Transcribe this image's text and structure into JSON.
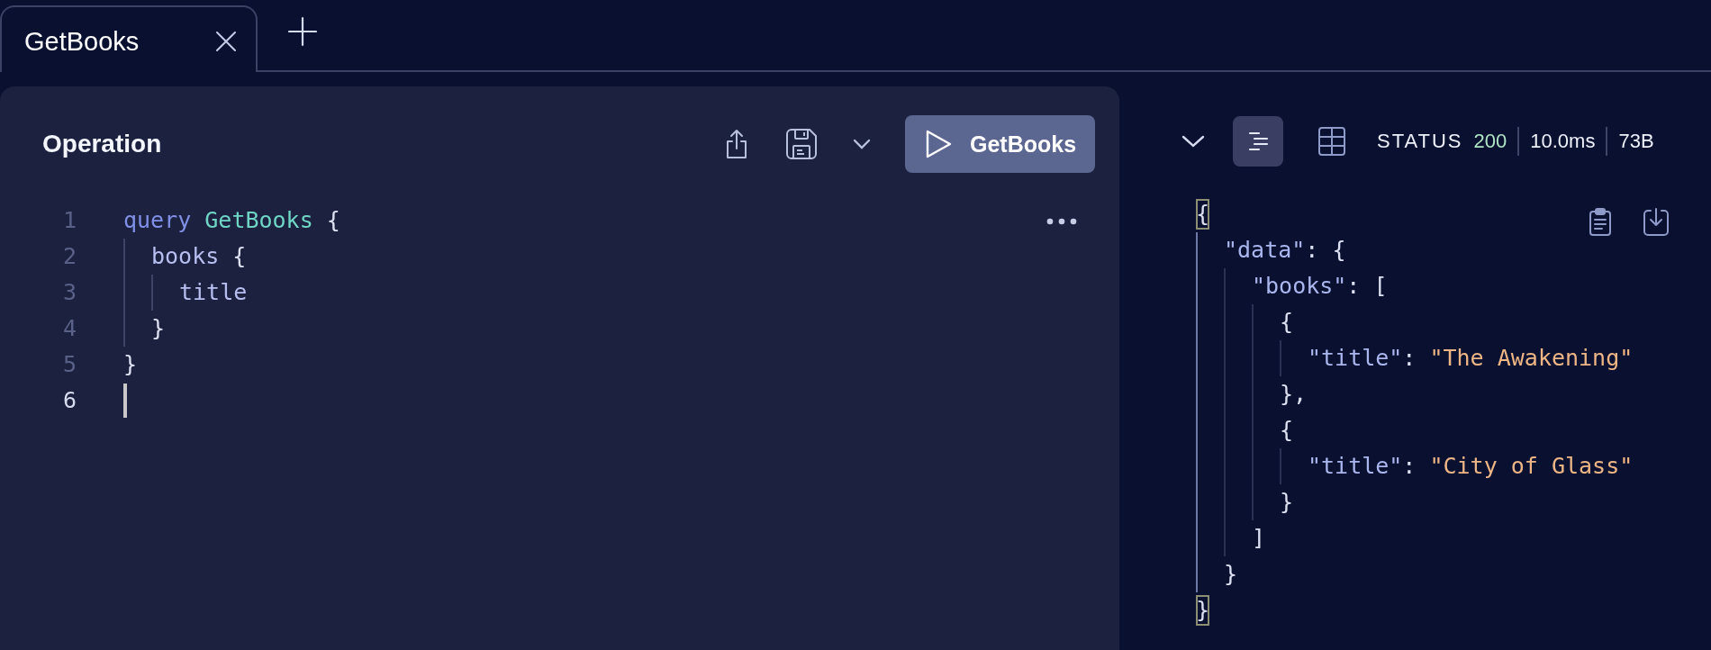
{
  "tabs": [
    {
      "label": "GetBooks",
      "selected": true
    }
  ],
  "operation": {
    "title": "Operation",
    "run_label": "GetBooks",
    "lines": [
      {
        "number": "1",
        "active": false,
        "tokens": [
          {
            "kind": "keyword",
            "text": "query"
          },
          {
            "kind": "name",
            "text": " GetBooks"
          },
          {
            "kind": "punct",
            "text": " {"
          }
        ],
        "children": [
          {
            "number": "2",
            "active": false,
            "tokens": [
              {
                "kind": "field",
                "text": "books"
              },
              {
                "kind": "punct",
                "text": " {"
              }
            ],
            "children": [
              {
                "number": "3",
                "active": false,
                "tokens": [
                  {
                    "kind": "field",
                    "text": "title"
                  }
                ]
              }
            ]
          },
          {
            "number": "4",
            "active": false,
            "tokens": [
              {
                "kind": "punct",
                "text": "}"
              }
            ]
          }
        ]
      },
      {
        "number": "5",
        "active": false,
        "tokens": [
          {
            "kind": "punct",
            "text": "}"
          }
        ]
      },
      {
        "number": "6",
        "active": true
      }
    ]
  },
  "response": {
    "view_modes": [
      {
        "kind": "formatted",
        "selected": true
      },
      {
        "kind": "table",
        "selected": false
      }
    ],
    "status_label": "STATUS",
    "status_code": "200",
    "time": "10.0ms",
    "size": "73B",
    "lines": [
      {
        "matched": true,
        "tokens": [
          {
            "kind": "punct",
            "text": "{"
          }
        ],
        "children": [
          {
            "matched": false,
            "tokens": [
              {
                "kind": "key",
                "text": "\"data\""
              },
              {
                "kind": "punct",
                "text": ": {"
              }
            ],
            "children": [
              {
                "matched": false,
                "tokens": [
                  {
                    "kind": "key",
                    "text": "\"books\""
                  },
                  {
                    "kind": "punct",
                    "text": ": ["
                  }
                ],
                "children": [
                  {
                    "matched": false,
                    "tokens": [
                      {
                        "kind": "punct",
                        "text": "{"
                      }
                    ],
                    "children": [
                      {
                        "matched": false,
                        "tokens": [
                          {
                            "kind": "key",
                            "text": "\"title\""
                          },
                          {
                            "kind": "punct",
                            "text": ": "
                          },
                          {
                            "kind": "string",
                            "text": "\"The Awakening\""
                          }
                        ]
                      }
                    ]
                  },
                  {
                    "matched": false,
                    "tokens": [
                      {
                        "kind": "punct",
                        "text": "},"
                      }
                    ]
                  },
                  {
                    "matched": false,
                    "tokens": [
                      {
                        "kind": "punct",
                        "text": "{"
                      }
                    ],
                    "children": [
                      {
                        "matched": false,
                        "tokens": [
                          {
                            "kind": "key",
                            "text": "\"title\""
                          },
                          {
                            "kind": "punct",
                            "text": ": "
                          },
                          {
                            "kind": "string",
                            "text": "\"City of Glass\""
                          }
                        ]
                      }
                    ]
                  },
                  {
                    "matched": false,
                    "tokens": [
                      {
                        "kind": "punct",
                        "text": "}"
                      }
                    ]
                  }
                ]
              },
              {
                "matched": false,
                "tokens": [
                  {
                    "kind": "punct",
                    "text": "]"
                  }
                ]
              }
            ]
          },
          {
            "matched": false,
            "tokens": [
              {
                "kind": "punct",
                "text": "}"
              }
            ]
          }
        ]
      },
      {
        "matched": true,
        "tokens": [
          {
            "kind": "punct",
            "text": "}"
          }
        ]
      }
    ]
  }
}
